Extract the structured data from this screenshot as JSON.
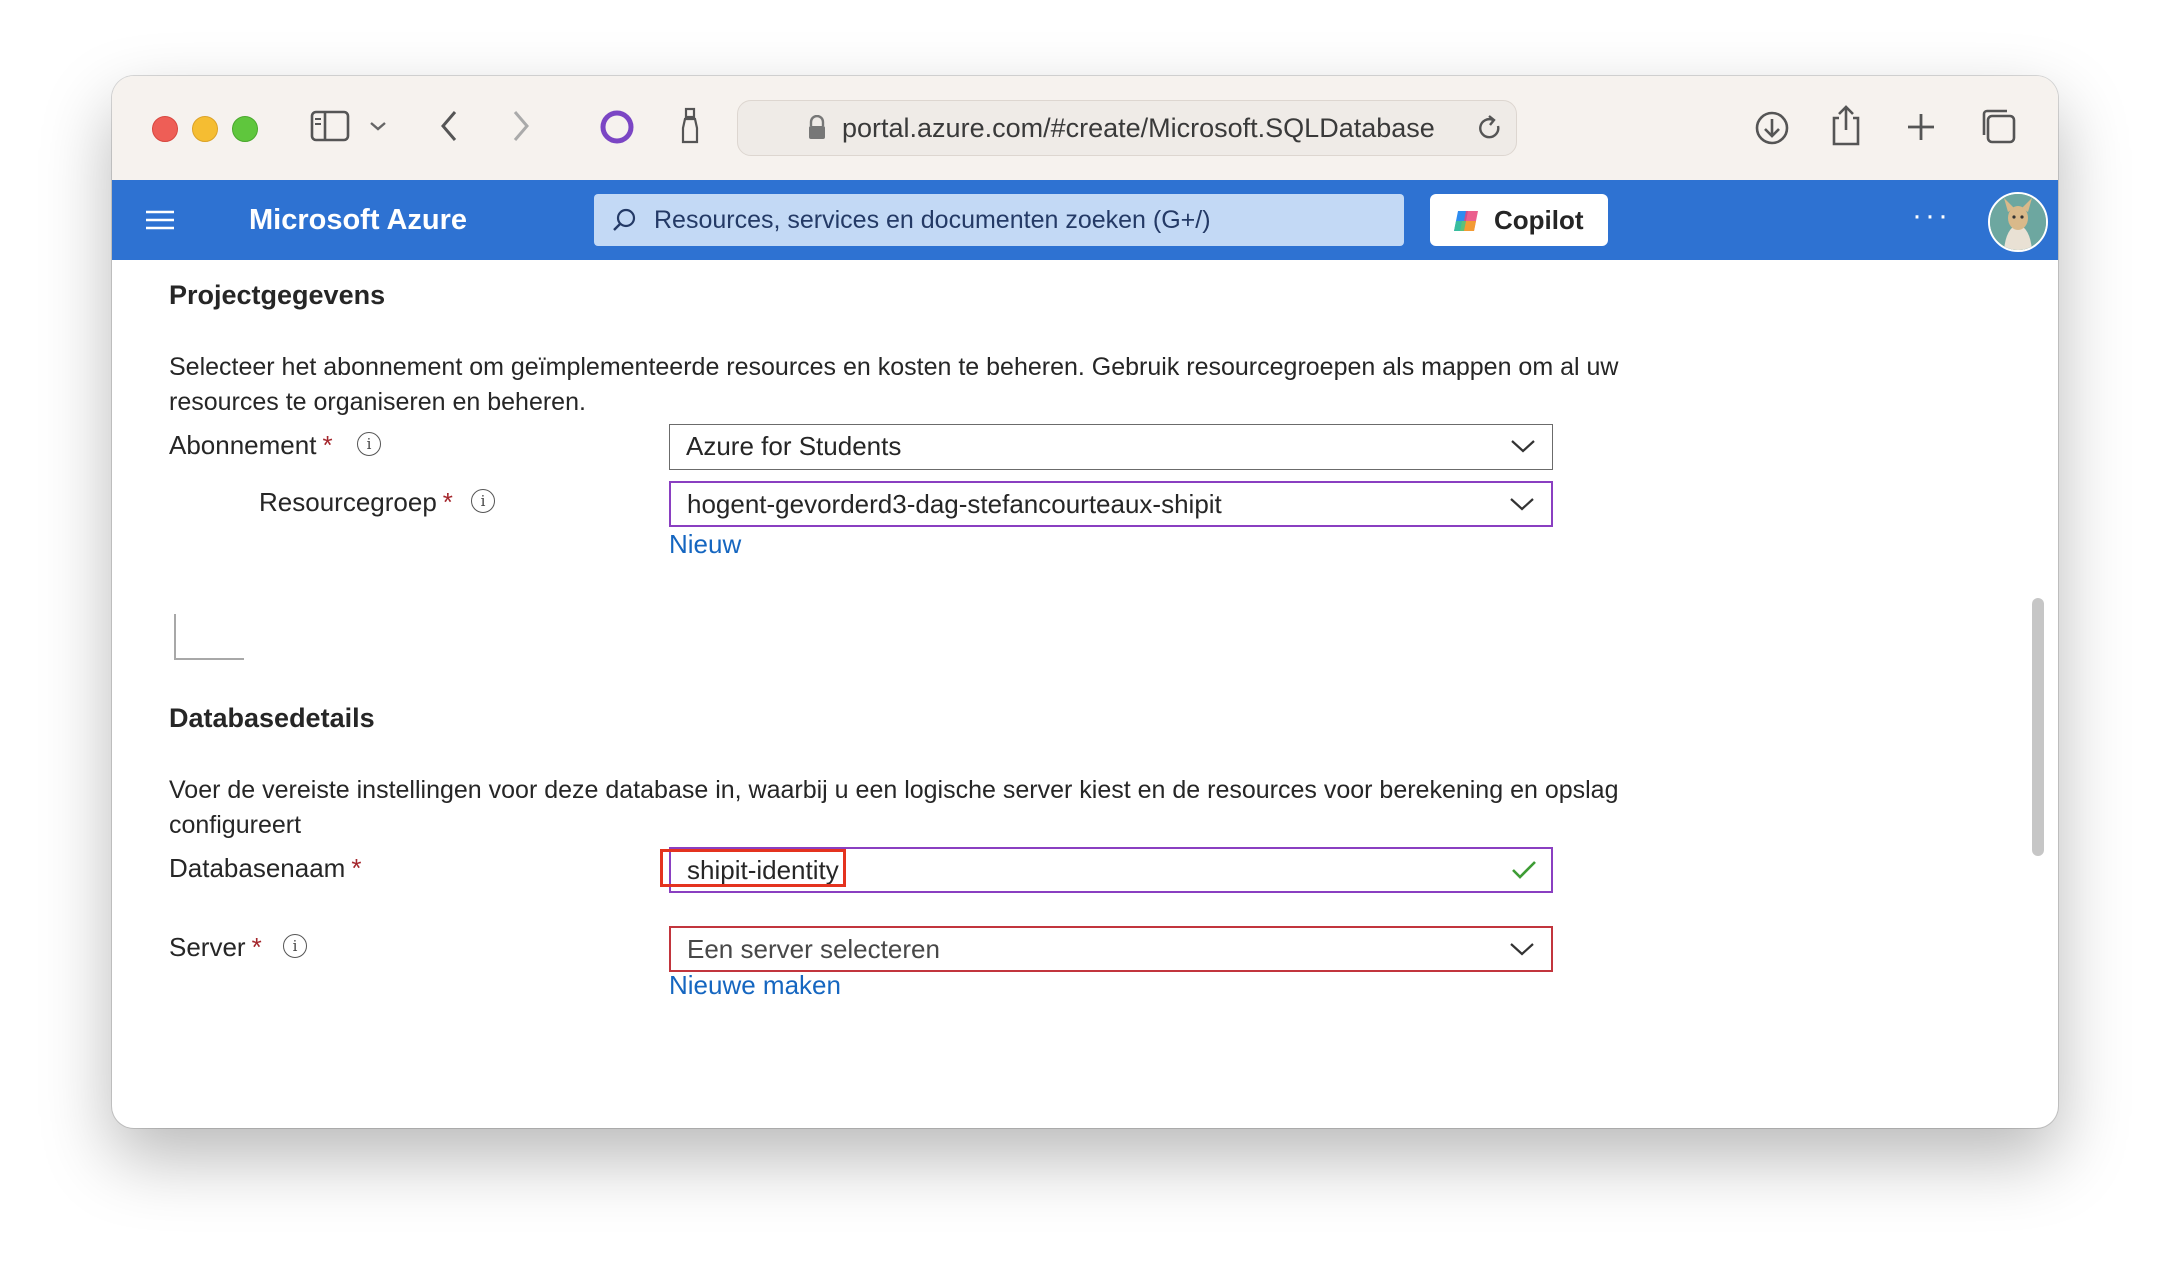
{
  "browser": {
    "url": "portal.azure.com/#create/Microsoft.SQLDatabase",
    "icons": [
      "sidebar-icon",
      "chevron-down-icon",
      "back-icon",
      "forward-icon",
      "extension-ring-icon",
      "extension-bottle-icon",
      "lock-icon",
      "reload-icon",
      "download-icon",
      "share-icon",
      "new-tab-icon",
      "tabs-overview-icon"
    ]
  },
  "header": {
    "brand": "Microsoft Azure",
    "search_placeholder": "Resources, services en documenten zoeken (G+/)",
    "copilot_label": "Copilot",
    "more": "···",
    "accent_color": "#2e72d2"
  },
  "project": {
    "title": "Projectgegevens",
    "description": "Selecteer het abonnement om geïmplementeerde resources en kosten te beheren. Gebruik resourcegroepen als mappen om al uw resources te organiseren en beheren.",
    "subscription": {
      "label": "Abonnement",
      "required": "*",
      "value": "Azure for Students"
    },
    "resource_group": {
      "label": "Resourcegroep",
      "required": "*",
      "value": "hogent-gevorderd3-dag-stefancourteaux-shipit",
      "new_link": "Nieuw"
    }
  },
  "database": {
    "title": "Databasedetails",
    "description": "Voer de vereiste instellingen voor deze database in, waarbij u een logische server kiest en de resources voor berekening en opslag configureert",
    "name": {
      "label": "Databasenaam",
      "required": "*",
      "value": "shipit-identity"
    },
    "server": {
      "label": "Server",
      "required": "*",
      "placeholder": "Een server selecteren",
      "new_link": "Nieuwe maken"
    }
  },
  "info_glyph": "i"
}
